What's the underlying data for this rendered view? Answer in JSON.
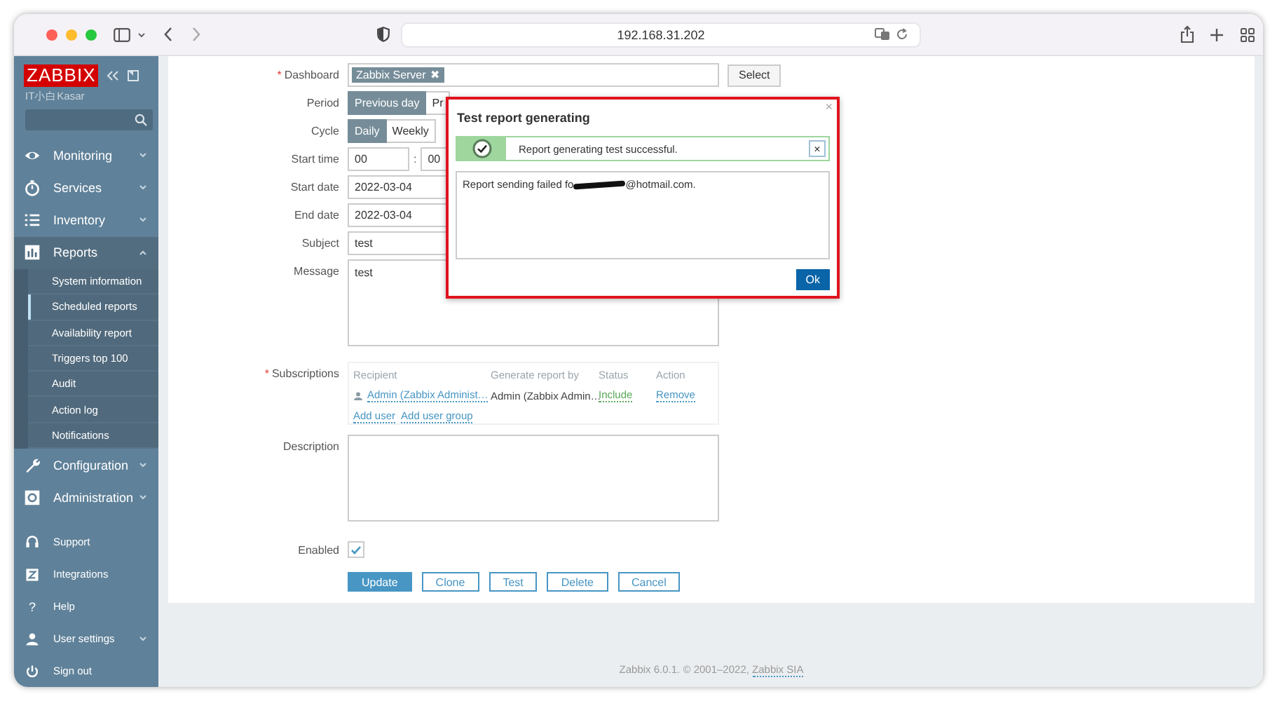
{
  "browser": {
    "address": "192.168.31.202"
  },
  "sidebar": {
    "logo": "ZABBIX",
    "server_name": "IT小白Kasar",
    "menu": [
      {
        "label": "Monitoring",
        "expanded": false
      },
      {
        "label": "Services",
        "expanded": false
      },
      {
        "label": "Inventory",
        "expanded": false
      },
      {
        "label": "Reports",
        "expanded": true,
        "children": [
          {
            "label": "System information",
            "selected": false
          },
          {
            "label": "Scheduled reports",
            "selected": true
          },
          {
            "label": "Availability report",
            "selected": false
          },
          {
            "label": "Triggers top 100",
            "selected": false
          },
          {
            "label": "Audit",
            "selected": false
          },
          {
            "label": "Action log",
            "selected": false
          },
          {
            "label": "Notifications",
            "selected": false
          }
        ]
      },
      {
        "label": "Configuration",
        "expanded": false
      },
      {
        "label": "Administration",
        "expanded": false
      }
    ],
    "user_menu": [
      {
        "label": "Support",
        "kind": "link"
      },
      {
        "label": "Integrations",
        "kind": "link"
      },
      {
        "label": "Help",
        "kind": "help",
        "icon_text": "?"
      },
      {
        "label": "User settings",
        "kind": "submenu"
      },
      {
        "label": "Sign out",
        "kind": "link"
      }
    ]
  },
  "form": {
    "dashboard": {
      "label": "Dashboard",
      "marker": "*",
      "tag": "Zabbix Server",
      "tag_remove": "✖",
      "button": "Select"
    },
    "period": {
      "label": "Period",
      "options": [
        {
          "label": "Previous day",
          "selected": true
        },
        {
          "label": "Pr",
          "selected": false
        }
      ]
    },
    "cycle": {
      "label": "Cycle",
      "options": [
        {
          "label": "Daily",
          "selected": true
        },
        {
          "label": "Weekly",
          "selected": false
        }
      ]
    },
    "start_time": {
      "label": "Start time",
      "hours": "00",
      "separator": ":",
      "minutes": "00"
    },
    "start_date": {
      "label": "Start date",
      "value": "2022-03-04"
    },
    "end_date": {
      "label": "End date",
      "value": "2022-03-04"
    },
    "subject": {
      "label": "Subject",
      "value": "test"
    },
    "message": {
      "label": "Message",
      "value": "test"
    },
    "subscriptions": {
      "label": "Subscriptions",
      "marker": "*",
      "columns": [
        "Recipient",
        "Generate report by",
        "Status",
        "Action"
      ],
      "rows": [
        {
          "recipient": "Admin (Zabbix Administ…",
          "generate_by": "Admin (Zabbix Admin…",
          "status": "Include",
          "action": "Remove"
        }
      ],
      "links": [
        "Add user",
        "Add user group"
      ]
    },
    "description": {
      "label": "Description"
    },
    "enabled": {
      "label": "Enabled",
      "checked": true
    },
    "buttons": [
      {
        "label": "Update",
        "kind": "primary"
      },
      {
        "label": "Clone",
        "kind": "secondary"
      },
      {
        "label": "Test",
        "kind": "secondary"
      },
      {
        "label": "Delete",
        "kind": "secondary"
      },
      {
        "label": "Cancel",
        "kind": "secondary"
      }
    ]
  },
  "dialog": {
    "title": "Test report generating",
    "close": "×",
    "message": {
      "kind": "success",
      "text": "Report generating test successful.",
      "close": "×"
    },
    "result_before": "Report sending failed fo",
    "result_after": "@hotmail.com.",
    "button": "Ok"
  },
  "footer": {
    "text": "Zabbix 6.0.1. © 2001–2022, ",
    "link": "Zabbix SIA"
  }
}
